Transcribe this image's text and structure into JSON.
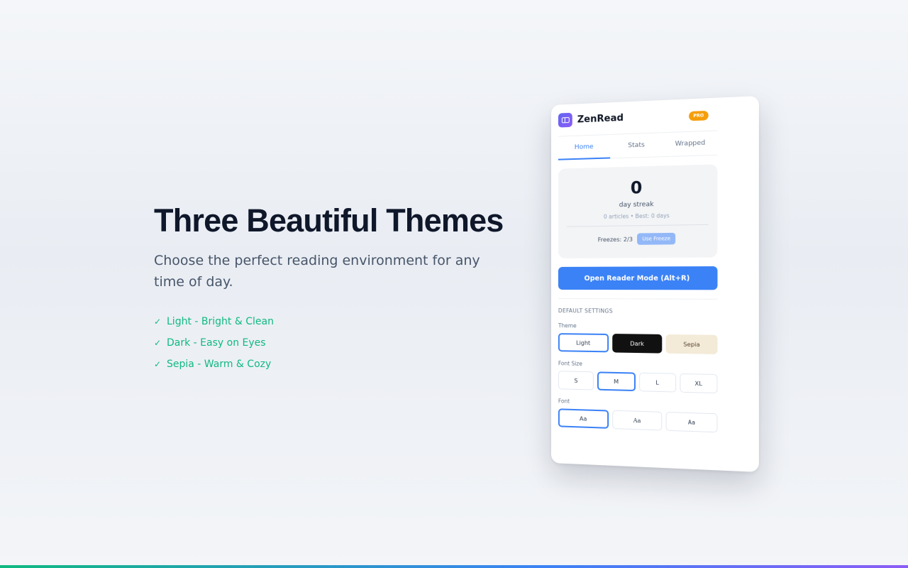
{
  "hero": {
    "title": "Three Beautiful Themes",
    "subtitle": "Choose the perfect reading environment for any time of day.",
    "features": [
      {
        "icon": "check-icon",
        "label": "Light - Bright & Clean"
      },
      {
        "icon": "check-icon",
        "label": "Dark - Easy on Eyes"
      },
      {
        "icon": "check-icon",
        "label": "Sepia - Warm & Cozy"
      }
    ]
  },
  "popup": {
    "brand": "ZenRead",
    "badge": "PRO",
    "tabs": [
      "Home",
      "Stats",
      "Wrapped"
    ],
    "active_tab": "Home",
    "streak": {
      "count": "0",
      "label": "day streak",
      "sub": "0 articles • Best: 0 days",
      "freezes": "Freezes: 2/3",
      "freeze_button": "Use Freeze"
    },
    "open_button": "Open Reader Mode (Alt+R)",
    "settings": {
      "section_title": "DEFAULT SETTINGS",
      "theme_label": "Theme",
      "themes": [
        "Light",
        "Dark",
        "Sepia"
      ],
      "theme_selected": "Light",
      "font_size_label": "Font Size",
      "font_sizes": [
        "S",
        "M",
        "L",
        "XL"
      ],
      "font_size_selected": "M",
      "font_label": "Font",
      "fonts": [
        "Aa",
        "Aa",
        "Aa"
      ],
      "font_selected_index": 0
    }
  },
  "colors": {
    "accent": "#3b82f6",
    "success": "#10b981",
    "badge": "#f59e0b",
    "logo": "#6366f1"
  }
}
